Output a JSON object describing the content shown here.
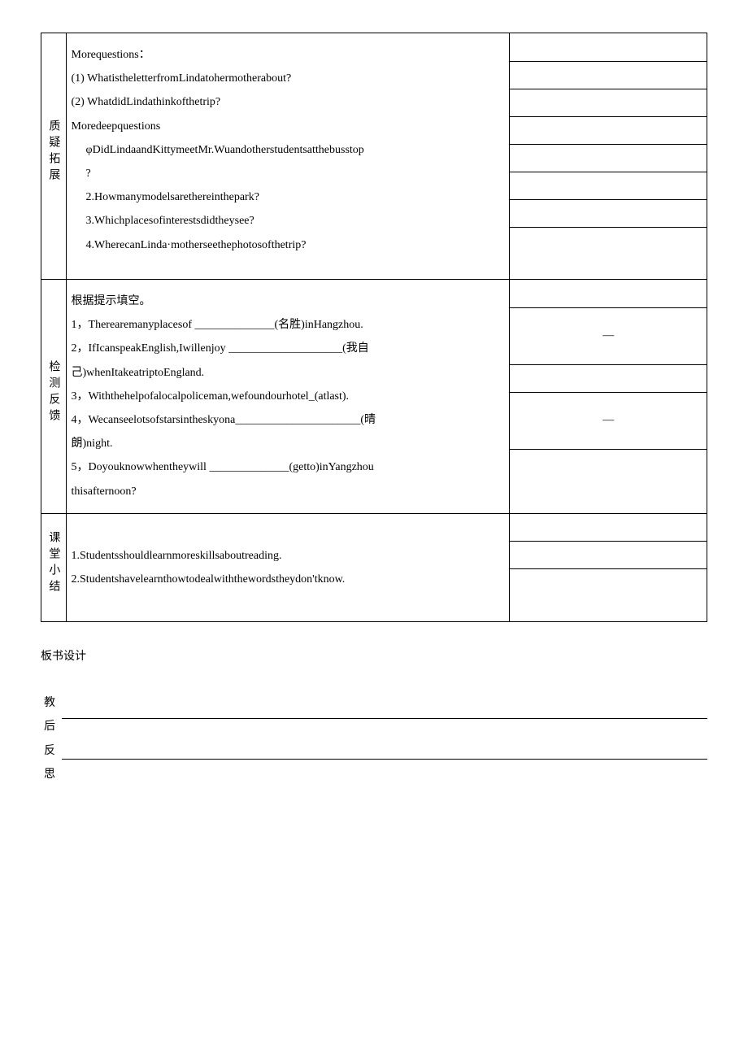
{
  "section1": {
    "label": "质疑拓展",
    "lines": [
      "Morequestions：",
      "(1) WhatistheletterfromLindatohermotherabout?",
      "(2) WhatdidLindathinkofthetrip?",
      "Moredeepquestions",
      "φDidLindaandKittymeetMr.Wuandotherstudentsatthebusstop",
      "?",
      "2.Howmanymodelsarethereinthepark?",
      "3.Whichplacesofinterestsdidtheysee?",
      "4.WherecanLinda·motherseethephotosofthetrip?"
    ]
  },
  "section2": {
    "label": "检测反馈",
    "lines": [
      "根据提示填空。",
      "1，Therearemanyplacesof ______________(名胜)inHangzhou.",
      "2，IfIcanspeakEnglish,Iwillenjoy ____________________(我自",
      "己)whenItakeatriptoEngland.",
      "3，Withthehelpofalocalpoliceman,wefoundourhotel_(atlast).",
      "4，Wecanseelotsofstarsintheskyona______________________(晴",
      "朗)night.",
      "5，Doyouknowwhentheywill ______________(getto)inYangzhou",
      "thisafternoon?"
    ],
    "rightMarks": [
      "",
      "—",
      "",
      "—",
      ""
    ]
  },
  "section3": {
    "label": "课堂小结",
    "lines": [
      "1.Studentsshouldlearnmoreskillsaboutreading.",
      "2.Studentshavelearnthowtodealwiththewordstheydon'tknow."
    ]
  },
  "boardDesign": "板书设计",
  "reflectionLabel": "教后反思"
}
